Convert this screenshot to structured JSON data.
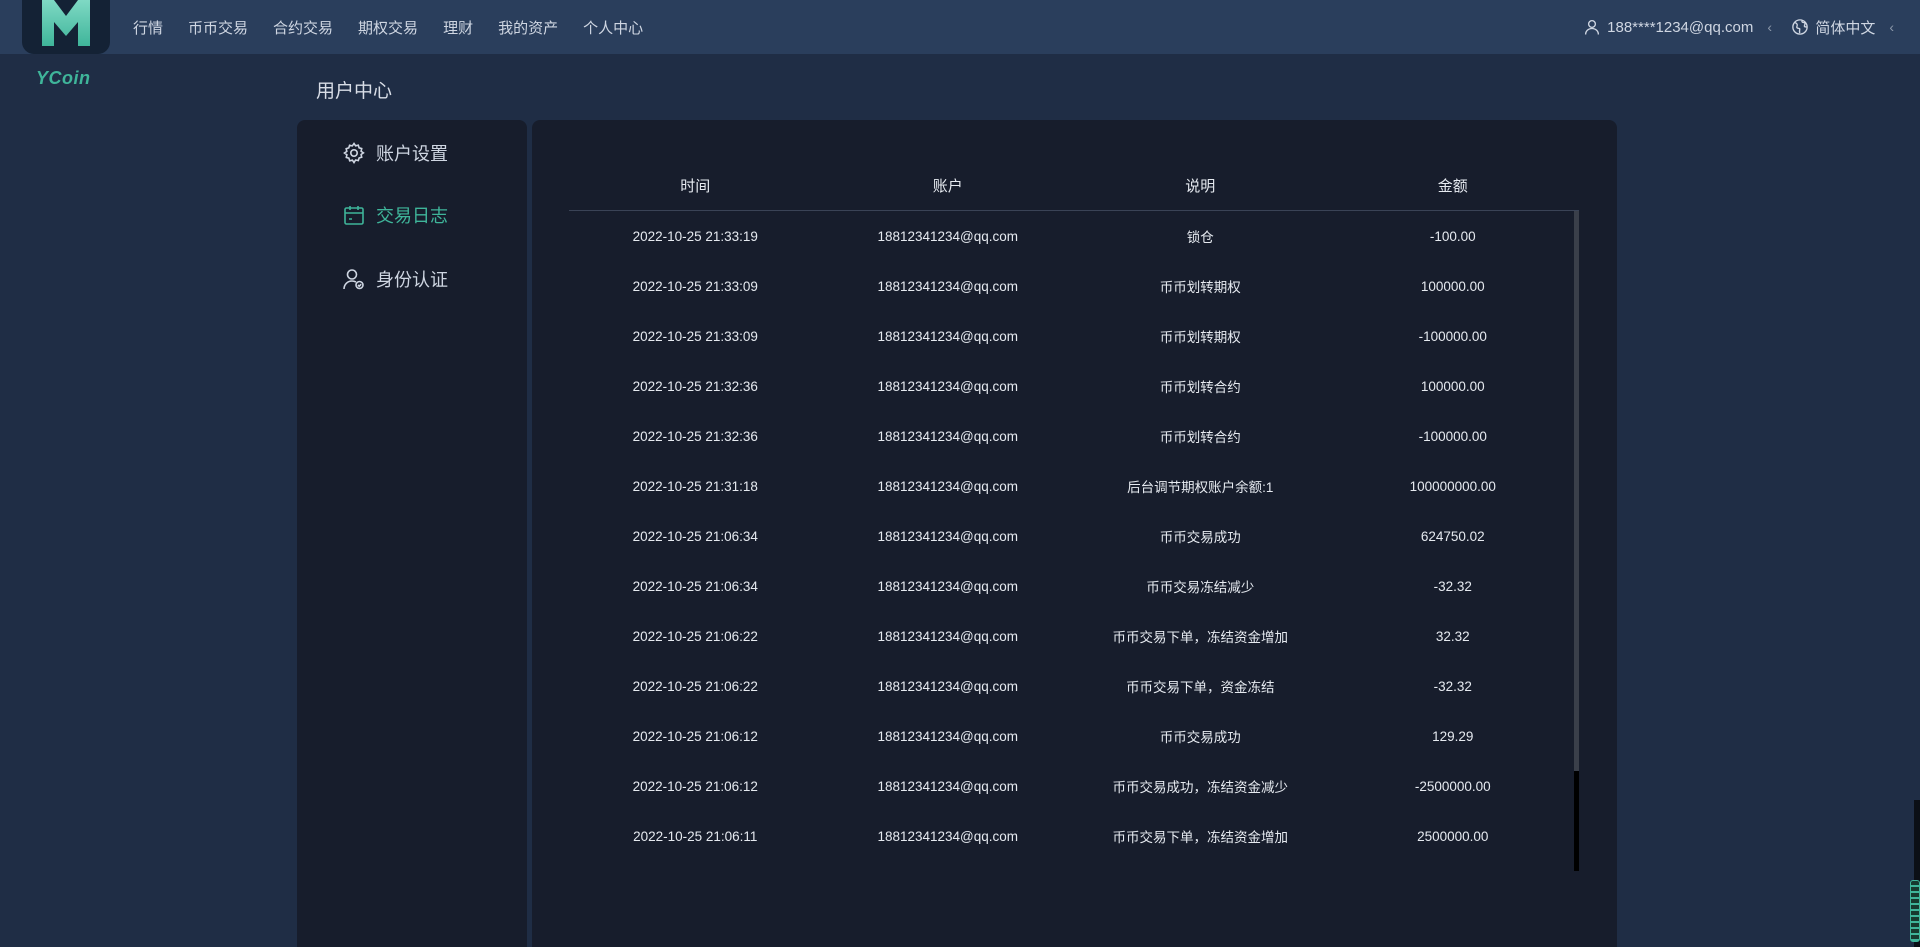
{
  "header": {
    "brand": "YCoin",
    "nav": [
      "行情",
      "币币交易",
      "合约交易",
      "期权交易",
      "理财",
      "我的资产",
      "个人中心"
    ],
    "user": "188****1234@qq.com",
    "language": "简体中文"
  },
  "page": {
    "title": "用户中心"
  },
  "sidebar": {
    "items": [
      {
        "label": "账户设置",
        "icon": "gear-icon"
      },
      {
        "label": "交易日志",
        "icon": "calendar-icon"
      },
      {
        "label": "身份认证",
        "icon": "user-verify-icon"
      }
    ],
    "active_index": 1
  },
  "table": {
    "headers": [
      "时间",
      "账户",
      "说明",
      "金额"
    ],
    "rows": [
      [
        "2022-10-25 21:33:19",
        "18812341234@qq.com",
        "锁仓",
        "-100.00"
      ],
      [
        "2022-10-25 21:33:09",
        "18812341234@qq.com",
        "币币划转期权",
        "100000.00"
      ],
      [
        "2022-10-25 21:33:09",
        "18812341234@qq.com",
        "币币划转期权",
        "-100000.00"
      ],
      [
        "2022-10-25 21:32:36",
        "18812341234@qq.com",
        "币币划转合约",
        "100000.00"
      ],
      [
        "2022-10-25 21:32:36",
        "18812341234@qq.com",
        "币币划转合约",
        "-100000.00"
      ],
      [
        "2022-10-25 21:31:18",
        "18812341234@qq.com",
        "后台调节期权账户余额:1",
        "100000000.00"
      ],
      [
        "2022-10-25 21:06:34",
        "18812341234@qq.com",
        "币币交易成功",
        "624750.02"
      ],
      [
        "2022-10-25 21:06:34",
        "18812341234@qq.com",
        "币币交易冻结减少",
        "-32.32"
      ],
      [
        "2022-10-25 21:06:22",
        "18812341234@qq.com",
        "币币交易下单，冻结资金增加",
        "32.32"
      ],
      [
        "2022-10-25 21:06:22",
        "18812341234@qq.com",
        "币币交易下单，资金冻结",
        "-32.32"
      ],
      [
        "2022-10-25 21:06:12",
        "18812341234@qq.com",
        "币币交易成功",
        "129.29"
      ],
      [
        "2022-10-25 21:06:12",
        "18812341234@qq.com",
        "币币交易成功，冻结资金减少",
        "-2500000.00"
      ],
      [
        "2022-10-25 21:06:11",
        "18812341234@qq.com",
        "币币交易下单，冻结资金增加",
        "2500000.00"
      ]
    ]
  },
  "colors": {
    "accent": "#3fb59a",
    "background": "#1f2d45",
    "topbar": "#2a3e5c",
    "panel": "#171d2c"
  }
}
